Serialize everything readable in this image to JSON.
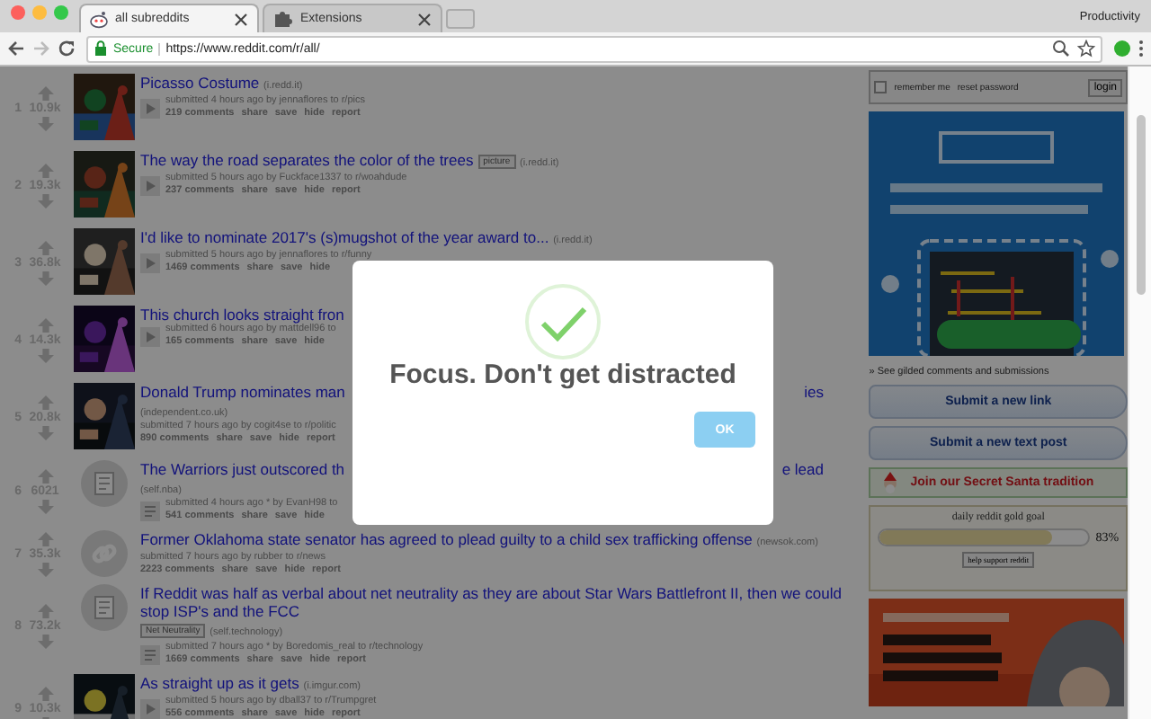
{
  "browser": {
    "tabs": [
      {
        "title": "all subreddits",
        "selected": true,
        "kind": "reddit"
      },
      {
        "title": "Extensions",
        "selected": false,
        "kind": "puzzle"
      }
    ],
    "profile": "Productivity",
    "security": "Secure",
    "url": "https://www.reddit.com/r/all/"
  },
  "posts": [
    {
      "rank": "1",
      "score": "10.9k",
      "thumbnail": {
        "kind": "picture"
      },
      "title": "Picasso Costume",
      "domain": "(i.redd.it)",
      "expando": {
        "kind": "video"
      },
      "meta": "submitted 4 hours ago by jennaflores to r/pics",
      "comments": "219 comments",
      "actions": [
        "share",
        "save",
        "hide",
        "report"
      ]
    },
    {
      "rank": "2",
      "score": "19.3k",
      "thumbnail": {
        "kind": "picture"
      },
      "title": "The way the road separates the color of the trees",
      "flair": "picture",
      "domain": "(i.redd.it)",
      "expando": {
        "kind": "video"
      },
      "meta": "submitted 5 hours ago by Fuckface1337 to r/woahdude",
      "comments": "237 comments",
      "actions": [
        "share",
        "save",
        "hide",
        "report"
      ]
    },
    {
      "rank": "3",
      "score": "36.8k",
      "thumbnail": {
        "kind": "picture"
      },
      "title": "I'd like to nominate 2017's (s)mugshot of the year award to...",
      "domain": "(i.redd.it)",
      "expando": {
        "kind": "video"
      },
      "meta": "submitted 5 hours ago by jennaflores to r/funny",
      "comments": "1469 comments",
      "actions": [
        "share",
        "save",
        "hide"
      ]
    },
    {
      "rank": "4",
      "score": "14.3k",
      "thumbnail": {
        "kind": "picture"
      },
      "title": "This church looks straight fron",
      "expando": {
        "kind": "video"
      },
      "meta": "submitted 6 hours ago by mattdell96 to",
      "comments": "165 comments",
      "actions": [
        "share",
        "save",
        "hide"
      ]
    },
    {
      "rank": "5",
      "score": "20.8k",
      "thumbnail": {
        "kind": "picture"
      },
      "title": "Donald Trump nominates man",
      "title_tail": "ies",
      "domain": "(independent.co.uk)",
      "meta": "submitted 7 hours ago by cogit4se to r/politic",
      "comments": "890 comments",
      "actions": [
        "share",
        "save",
        "hide",
        "report"
      ]
    },
    {
      "rank": "6",
      "score": "6021",
      "thumbnail": {
        "kind": "self"
      },
      "title": "The Warriors just outscored th",
      "title_tail": "e lead",
      "domain": "(self.nba)",
      "expando": {
        "kind": "text"
      },
      "meta": "submitted 4 hours ago * by EvanH98 to",
      "comments": "541 comments",
      "actions": [
        "share",
        "save",
        "hide"
      ]
    },
    {
      "rank": "7",
      "score": "35.3k",
      "thumbnail": {
        "kind": "link"
      },
      "title": "Former Oklahoma state senator has agreed to plead guilty to a child sex trafficking offense",
      "domain": "(newsok.com)",
      "meta": "submitted 7 hours ago by rubber to r/news",
      "comments": "2223 comments",
      "actions": [
        "share",
        "save",
        "hide",
        "report"
      ]
    },
    {
      "rank": "8",
      "score": "73.2k",
      "thumbnail": {
        "kind": "self"
      },
      "title": "If Reddit was half as verbal about net neutrality as they are about Star Wars Battlefront II, then we could stop ISP's and the FCC",
      "flair": "Net Neutrality",
      "domain": "(self.technology)",
      "expando": {
        "kind": "text"
      },
      "meta": "submitted 7 hours ago * by Boredomis_real to r/technology",
      "comments": "1669 comments",
      "actions": [
        "share",
        "save",
        "hide",
        "report"
      ]
    },
    {
      "rank": "9",
      "score": "10.3k",
      "thumbnail": {
        "kind": "picture"
      },
      "title": "As straight up as it gets",
      "domain": "(i.imgur.com)",
      "expando": {
        "kind": "video"
      },
      "meta": "submitted 5 hours ago by dball37 to r/Trumpgret",
      "comments": "556 comments",
      "actions": [
        "share",
        "save",
        "hide",
        "report"
      ]
    }
  ],
  "sidebar": {
    "login": {
      "remember_label": "remember me",
      "remember_checked": false,
      "reset": "reset password",
      "button": "login"
    },
    "ad_top": {
      "kind": "picture"
    },
    "gilded_link": "» See gilded comments and submissions",
    "submit_buttons": [
      "Submit a new link",
      "Submit a new text post"
    ],
    "santa": "Join our Secret Santa tradition",
    "gold": {
      "title": "daily reddit gold goal",
      "level": 0.83,
      "percent": "83%",
      "button": "help support reddit"
    },
    "ad_bottom": {
      "kind": "picture"
    }
  },
  "modal": {
    "message": "Focus. Don't get distracted",
    "button": "OK"
  }
}
